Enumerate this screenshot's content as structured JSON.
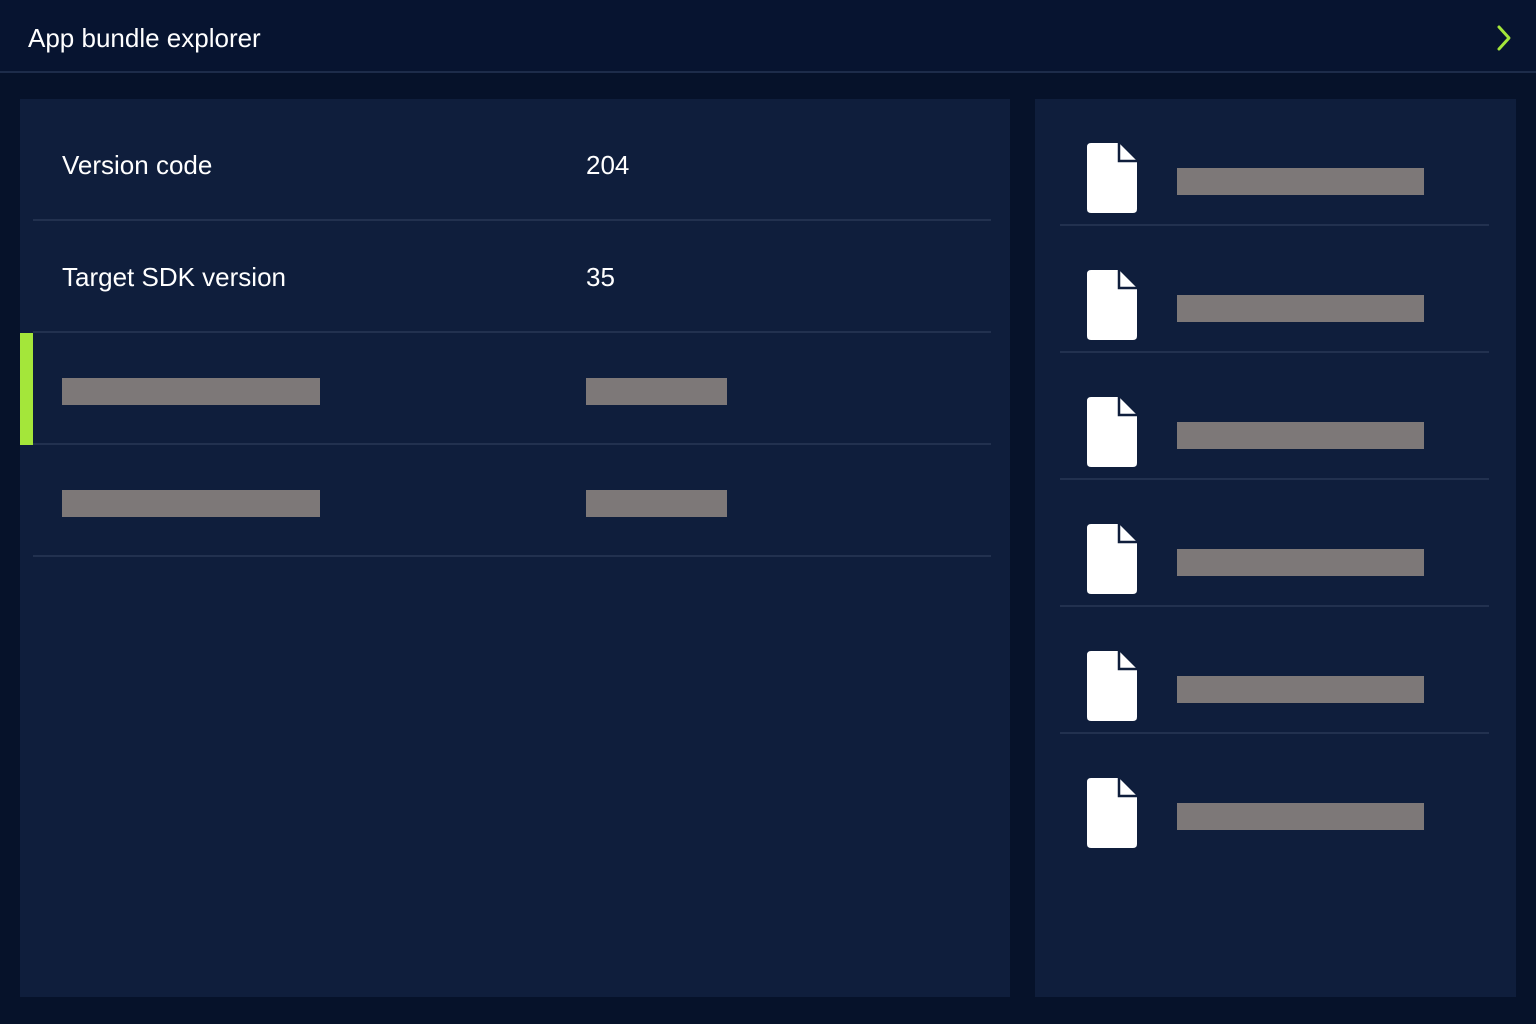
{
  "header": {
    "title": "App bundle explorer",
    "next_icon": "chevron-right-icon",
    "accent_color": "#a4e63a"
  },
  "properties": [
    {
      "name": "Version code",
      "value": "204"
    },
    {
      "name": "Target SDK version",
      "value": "35"
    }
  ],
  "placeholder_color": "#7d7878",
  "files": {
    "icon": "file-icon"
  }
}
